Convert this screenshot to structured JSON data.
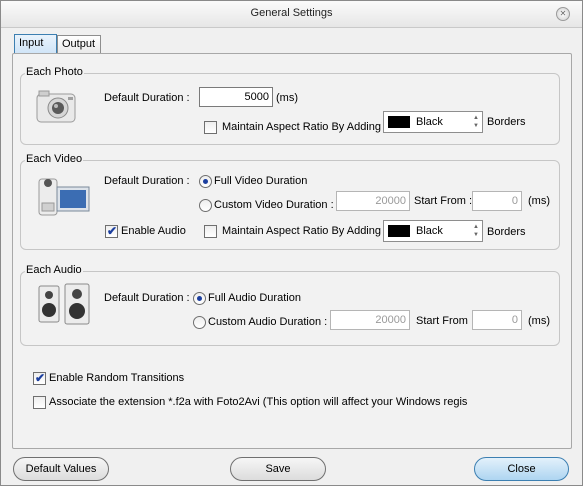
{
  "window": {
    "title": "General Settings"
  },
  "tabs": [
    {
      "label": "Input"
    },
    {
      "label": "Output"
    }
  ],
  "photo": {
    "group_title": "Each Photo",
    "default_duration_label": "Default Duration :",
    "duration_value": "5000",
    "unit": "(ms)",
    "maintain_aspect_label": "Maintain Aspect Ratio By Adding",
    "border_color": "Black",
    "borders_label": "Borders"
  },
  "video": {
    "group_title": "Each Video",
    "default_duration_label": "Default Duration :",
    "full_duration_label": "Full Video Duration",
    "custom_duration_label": "Custom Video Duration :",
    "custom_duration_value": "20000",
    "start_from_label": "Start From :",
    "start_from_value": "0",
    "unit": "(ms)",
    "enable_audio_label": "Enable Audio",
    "maintain_aspect_label": "Maintain Aspect Ratio By Adding",
    "border_color": "Black",
    "borders_label": "Borders"
  },
  "audio": {
    "group_title": "Each Audio",
    "default_duration_label": "Default Duration :",
    "full_duration_label": "Full Audio Duration",
    "custom_duration_label": "Custom Audio Duration :",
    "custom_duration_value": "20000",
    "start_from_label": "Start From :",
    "start_from_value": "0",
    "unit": "(ms)"
  },
  "options": {
    "random_transitions_label": "Enable Random Transitions",
    "associate_label": "Associate the extension *.f2a with Foto2Avi (This option will affect your Windows regis"
  },
  "buttons": {
    "default_values": "Default Values",
    "save": "Save",
    "close": "Close"
  },
  "glyphs": {
    "check": "✔",
    "close_x": "✕",
    "spin_up": "▲",
    "spin_down": "▼"
  },
  "colors": {
    "accent": "#3c7fb1",
    "border_swatch": "#000000"
  }
}
